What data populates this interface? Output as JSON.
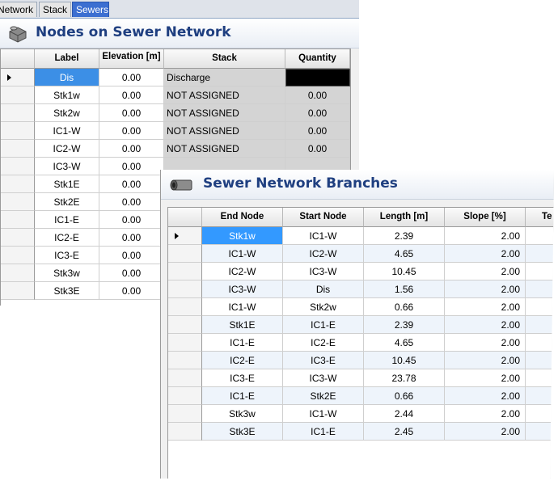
{
  "tabs": [
    "Network",
    "Stack",
    "Sewers"
  ],
  "nodes": {
    "title": "Nodes on Sewer Network",
    "columns": [
      "Label",
      "Elevation [m]",
      "Stack",
      "Quantity"
    ],
    "rows": [
      {
        "label": "Dis",
        "elevation": "0.00",
        "stack": "Discharge",
        "quantity": ""
      },
      {
        "label": "Stk1w",
        "elevation": "0.00",
        "stack": "NOT ASSIGNED",
        "quantity": "0.00"
      },
      {
        "label": "Stk2w",
        "elevation": "0.00",
        "stack": "NOT ASSIGNED",
        "quantity": "0.00"
      },
      {
        "label": "IC1-W",
        "elevation": "0.00",
        "stack": "NOT ASSIGNED",
        "quantity": "0.00"
      },
      {
        "label": "IC2-W",
        "elevation": "0.00",
        "stack": "NOT ASSIGNED",
        "quantity": "0.00"
      },
      {
        "label": "IC3-W",
        "elevation": "0.00",
        "stack": "",
        "quantity": ""
      },
      {
        "label": "Stk1E",
        "elevation": "0.00",
        "stack": "",
        "quantity": ""
      },
      {
        "label": "Stk2E",
        "elevation": "0.00",
        "stack": "",
        "quantity": ""
      },
      {
        "label": "IC1-E",
        "elevation": "0.00",
        "stack": "",
        "quantity": ""
      },
      {
        "label": "IC2-E",
        "elevation": "0.00",
        "stack": "",
        "quantity": ""
      },
      {
        "label": "IC3-E",
        "elevation": "0.00",
        "stack": "",
        "quantity": ""
      },
      {
        "label": "Stk3w",
        "elevation": "0.00",
        "stack": "",
        "quantity": ""
      },
      {
        "label": "Stk3E",
        "elevation": "0.00",
        "stack": "",
        "quantity": ""
      }
    ]
  },
  "branches": {
    "title": "Sewer Network Branches",
    "columns": [
      "End Node",
      "Start Node",
      "Length [m]",
      "Slope [%]",
      "Te"
    ],
    "rows": [
      {
        "end": "Stk1w",
        "start": "IC1-W",
        "length": "2.39",
        "slope": "2.00"
      },
      {
        "end": "IC1-W",
        "start": "IC2-W",
        "length": "4.65",
        "slope": "2.00"
      },
      {
        "end": "IC2-W",
        "start": "IC3-W",
        "length": "10.45",
        "slope": "2.00"
      },
      {
        "end": "IC3-W",
        "start": "Dis",
        "length": "1.56",
        "slope": "2.00"
      },
      {
        "end": "IC1-W",
        "start": "Stk2w",
        "length": "0.66",
        "slope": "2.00"
      },
      {
        "end": "Stk1E",
        "start": "IC1-E",
        "length": "2.39",
        "slope": "2.00"
      },
      {
        "end": "IC1-E",
        "start": "IC2-E",
        "length": "4.65",
        "slope": "2.00"
      },
      {
        "end": "IC2-E",
        "start": "IC3-E",
        "length": "10.45",
        "slope": "2.00"
      },
      {
        "end": "IC3-E",
        "start": "IC3-W",
        "length": "23.78",
        "slope": "2.00"
      },
      {
        "end": "IC1-E",
        "start": "Stk2E",
        "length": "0.66",
        "slope": "2.00"
      },
      {
        "end": "Stk3w",
        "start": "IC1-W",
        "length": "2.44",
        "slope": "2.00"
      },
      {
        "end": "Stk3E",
        "start": "IC1-E",
        "length": "2.45",
        "slope": "2.00"
      }
    ]
  },
  "icons": {
    "nodes": "sewer-node-icon",
    "branches": "pipe-icon",
    "current_row": "current-row-arrow-icon"
  },
  "colors": {
    "title": "#1f3f80",
    "selection": "#3399ff",
    "tab_active": "#3c6fd1"
  }
}
